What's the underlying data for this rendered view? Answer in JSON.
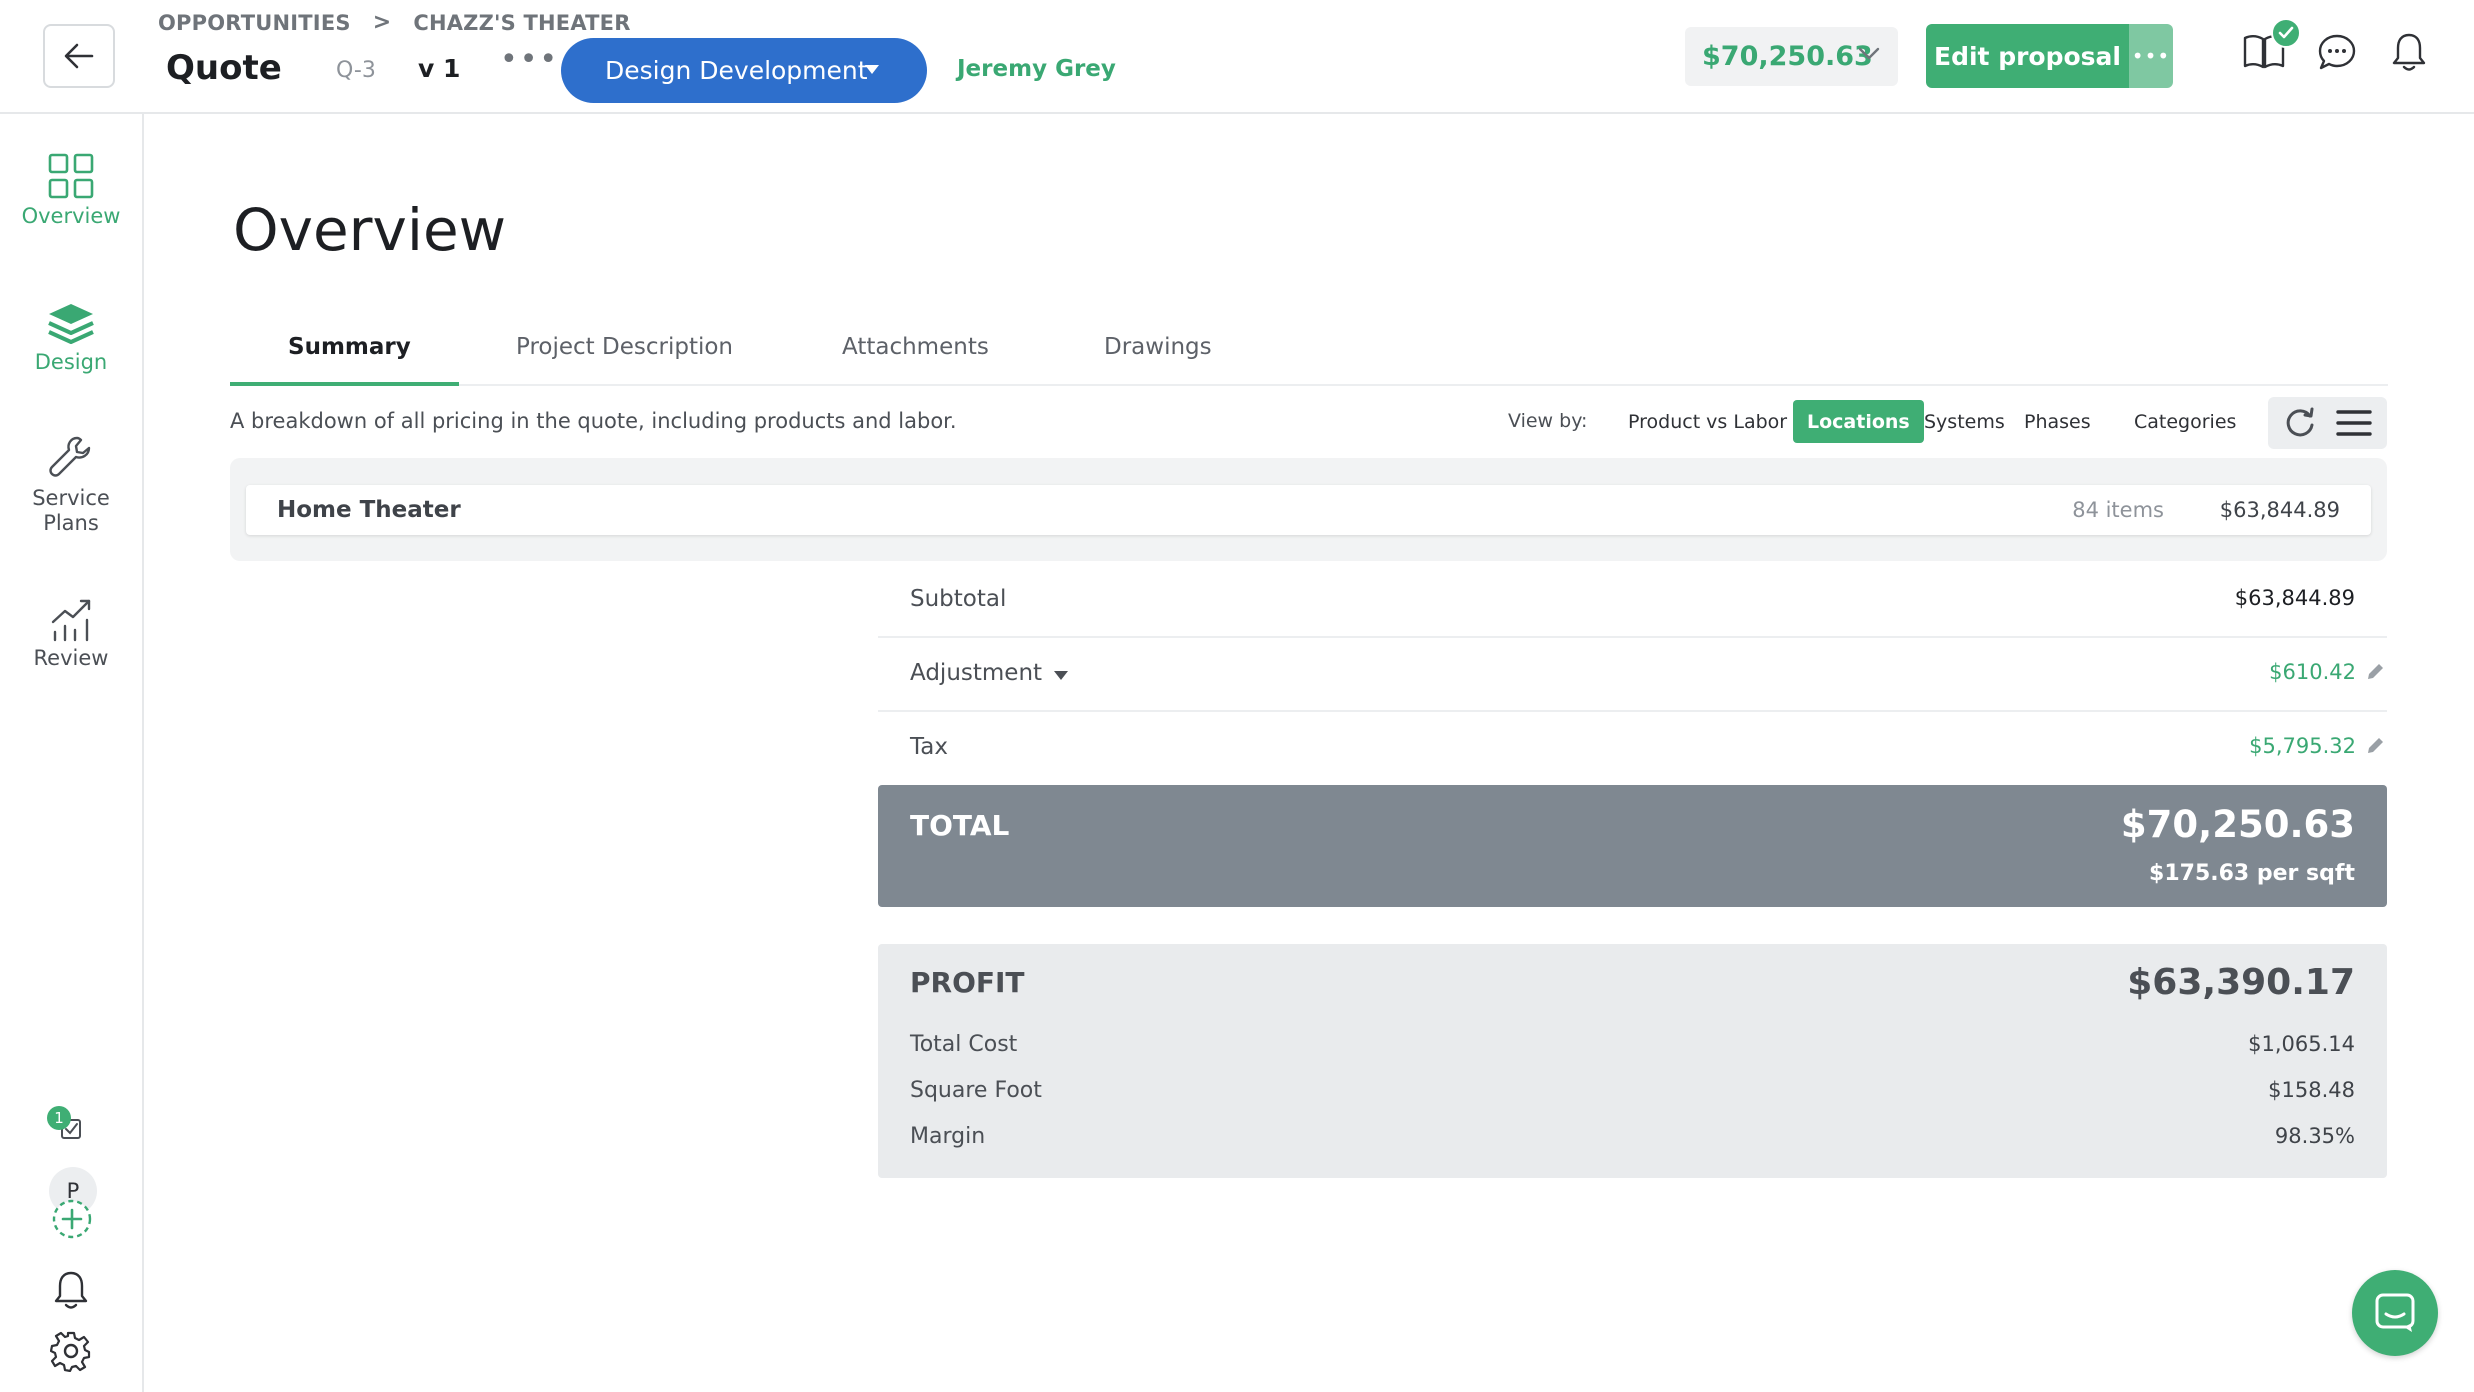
{
  "header": {
    "breadcrumb": [
      "OPPORTUNITIES",
      "CHAZZ'S THEATER"
    ],
    "breadcrumb_sep": ">",
    "title": "Quote",
    "quote_id": "Q-3",
    "version": "v 1",
    "more": "•••",
    "stage": "Design Development",
    "owner": "Jeremy Grey",
    "price": "$70,250.63",
    "edit_label": "Edit proposal",
    "edit_more": "•••",
    "icons": [
      "book-icon",
      "chat-bubble-icon",
      "bell-icon"
    ]
  },
  "sidebar": {
    "items": [
      {
        "label": "Overview",
        "icon": "grid-icon",
        "active": true
      },
      {
        "label": "Design",
        "icon": "layers-icon",
        "active": false
      },
      {
        "label": "Service Plans",
        "icon": "wrench-icon",
        "active": false
      },
      {
        "label": "Review",
        "icon": "chart-icon",
        "active": false
      }
    ],
    "tasks_count": "1",
    "avatar_initial": "P"
  },
  "main": {
    "heading": "Overview",
    "tabs": [
      "Summary",
      "Project Description",
      "Attachments",
      "Drawings"
    ],
    "active_tab": "Summary",
    "description": "A breakdown of all pricing in the quote, including products and labor.",
    "view_by_label": "View by:",
    "view_by_options": [
      "Product vs Labor",
      "Locations",
      "Systems",
      "Phases",
      "Categories"
    ],
    "view_by_active": "Locations",
    "group": {
      "name": "Home Theater",
      "count": "84 items",
      "total": "$63,844.89"
    },
    "summary": {
      "subtotal_label": "Subtotal",
      "subtotal_value": "$63,844.89",
      "adjustment_label": "Adjustment",
      "adjustment_value": "$610.42",
      "tax_label": "Tax",
      "tax_value": "$5,795.32"
    },
    "total": {
      "label": "TOTAL",
      "value": "$70,250.63",
      "per_sqft": "$175.63 per sqft"
    },
    "profit": {
      "label": "PROFIT",
      "value": "$63,390.17",
      "rows": [
        {
          "label": "Total Cost",
          "value": "$1,065.14"
        },
        {
          "label": "Square Foot",
          "value": "$158.48"
        },
        {
          "label": "Margin",
          "value": "98.35%"
        }
      ]
    }
  },
  "colors": {
    "accent_green": "#3fae74",
    "stage_blue": "#2e6fcc",
    "total_gray": "#7f8891"
  }
}
